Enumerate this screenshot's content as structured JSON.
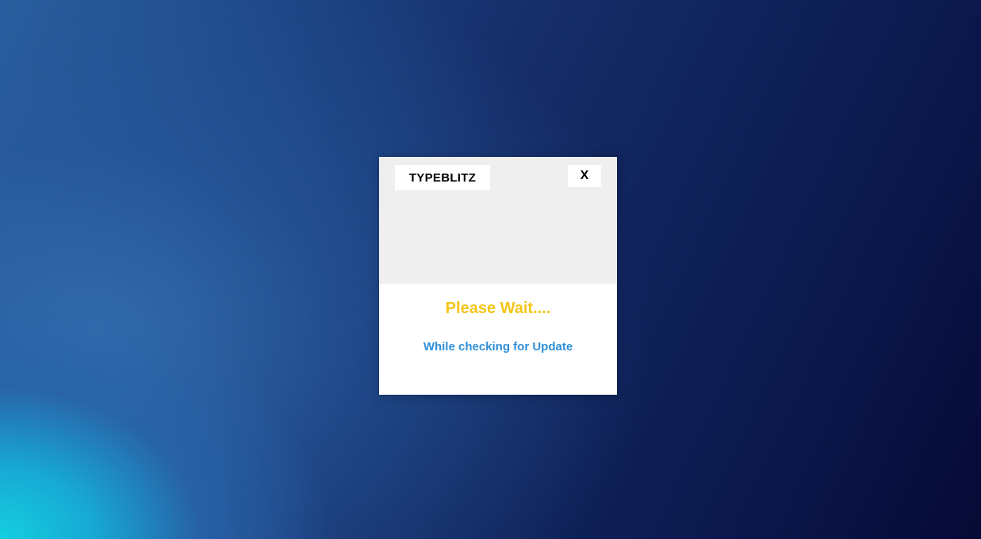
{
  "dialog": {
    "brand_label": "TYPEBLITZ",
    "close_label": "X",
    "title": "Please Wait....",
    "subtitle": "While checking for Update"
  },
  "colors": {
    "title": "#f5c518",
    "subtitle": "#2f8fd8",
    "header_bg": "#efefef",
    "dialog_bg": "#ffffff"
  },
  "icons": {
    "close": "close-icon"
  }
}
